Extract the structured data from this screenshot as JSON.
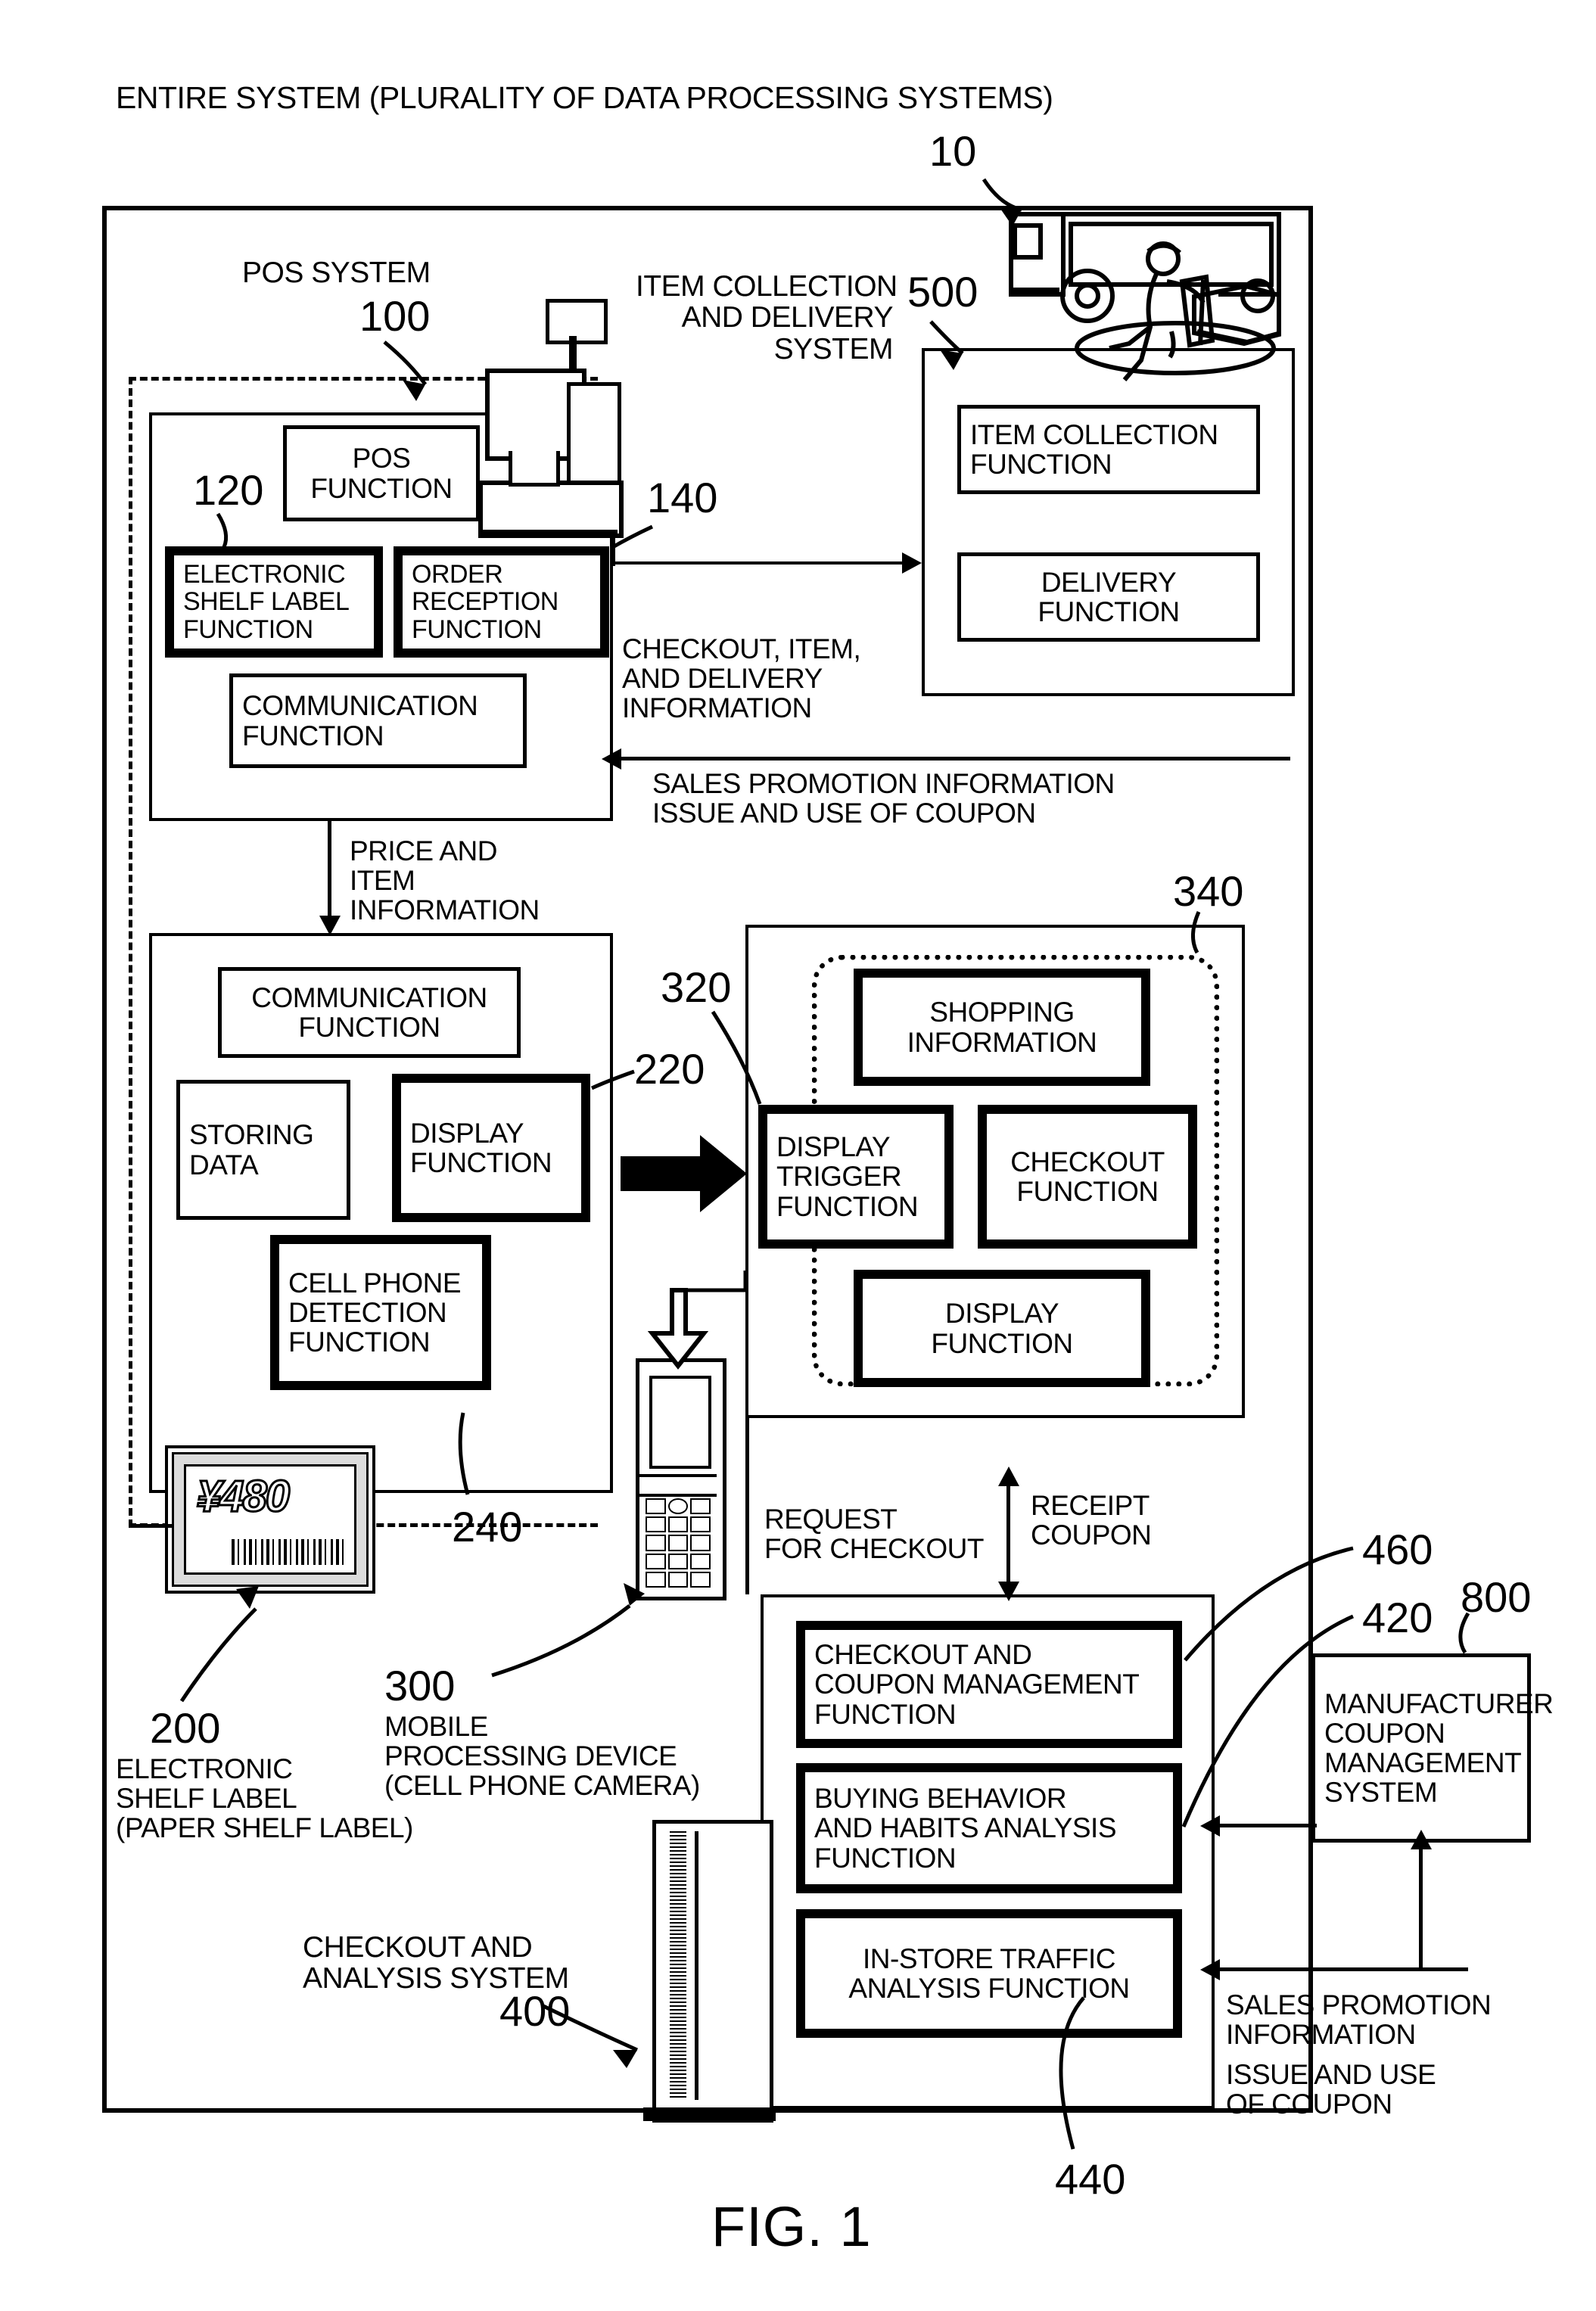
{
  "figure": {
    "caption": "FIG. 1"
  },
  "title": {
    "text": "ENTIRE SYSTEM (PLURALITY OF DATA PROCESSING SYSTEMS)",
    "ref": "10"
  },
  "pos_system": {
    "label": "POS SYSTEM",
    "ref": "100",
    "ref_esl": "120",
    "ref_order": "140",
    "boxes": {
      "pos_function": "POS\nFUNCTION",
      "electronic_shelf_label_function": "ELECTRONIC\nSHELF LABEL\nFUNCTION",
      "order_reception_function": "ORDER\nRECEPTION\nFUNCTION",
      "communication_function": "COMMUNICATION\nFUNCTION"
    }
  },
  "item_collection_delivery": {
    "label": "ITEM COLLECTION\nAND DELIVERY\nSYSTEM",
    "ref": "500",
    "boxes": {
      "item_collection_function": "ITEM COLLECTION\nFUNCTION",
      "delivery_function": "DELIVERY\nFUNCTION"
    }
  },
  "electronic_shelf_label": {
    "label": "ELECTRONIC\nSHELF LABEL\n(PAPER SHELF LABEL)",
    "ref": "200",
    "ref_display": "220",
    "ref_cellphone_detect": "240",
    "price_tag": "¥480",
    "boxes": {
      "communication_function": "COMMUNICATION\nFUNCTION",
      "storing_data": "STORING\nDATA",
      "display_function": "DISPLAY\nFUNCTION",
      "cell_phone_detection_function": "CELL PHONE\nDETECTION\nFUNCTION"
    }
  },
  "mobile_device": {
    "label": "MOBILE\nPROCESSING DEVICE\n(CELL PHONE CAMERA)",
    "ref": "300",
    "ref_display_trigger": "320",
    "ref_group": "340",
    "boxes": {
      "shopping_information": "SHOPPING\nINFORMATION",
      "display_trigger_function": "DISPLAY\nTRIGGER\nFUNCTION",
      "checkout_function": "CHECKOUT\nFUNCTION",
      "display_function": "DISPLAY\nFUNCTION"
    }
  },
  "checkout_analysis_system": {
    "label": "CHECKOUT AND\nANALYSIS SYSTEM",
    "ref": "400",
    "ref_checkout_coupon": "460",
    "ref_buying_behavior": "420",
    "ref_in_store_traffic": "440",
    "boxes": {
      "checkout_and_coupon_management_function": "CHECKOUT AND\nCOUPON MANAGEMENT\nFUNCTION",
      "buying_behavior_and_habits_analysis_function": "BUYING BEHAVIOR\nAND HABITS ANALYSIS\nFUNCTION",
      "in_store_traffic_analysis_function": "IN-STORE TRAFFIC\nANALYSIS FUNCTION"
    }
  },
  "manufacturer_coupon_system": {
    "label": "MANUFACTURER\nCOUPON\nMANAGEMENT\nSYSTEM",
    "ref": "800"
  },
  "flow_labels": {
    "checkout_item_delivery": "CHECKOUT, ITEM,\nAND DELIVERY\nINFORMATION",
    "sales_promotion_top": "SALES PROMOTION INFORMATION\nISSUE AND USE OF COUPON",
    "price_and_item": "PRICE AND\nITEM\nINFORMATION",
    "request_for_checkout": "REQUEST\nFOR CHECKOUT",
    "receipt_coupon": "RECEIPT\nCOUPON",
    "sales_promotion_bottom": "SALES PROMOTION\nINFORMATION",
    "issue_use_coupon_bottom": "ISSUE AND USE\nOF COUPON"
  }
}
